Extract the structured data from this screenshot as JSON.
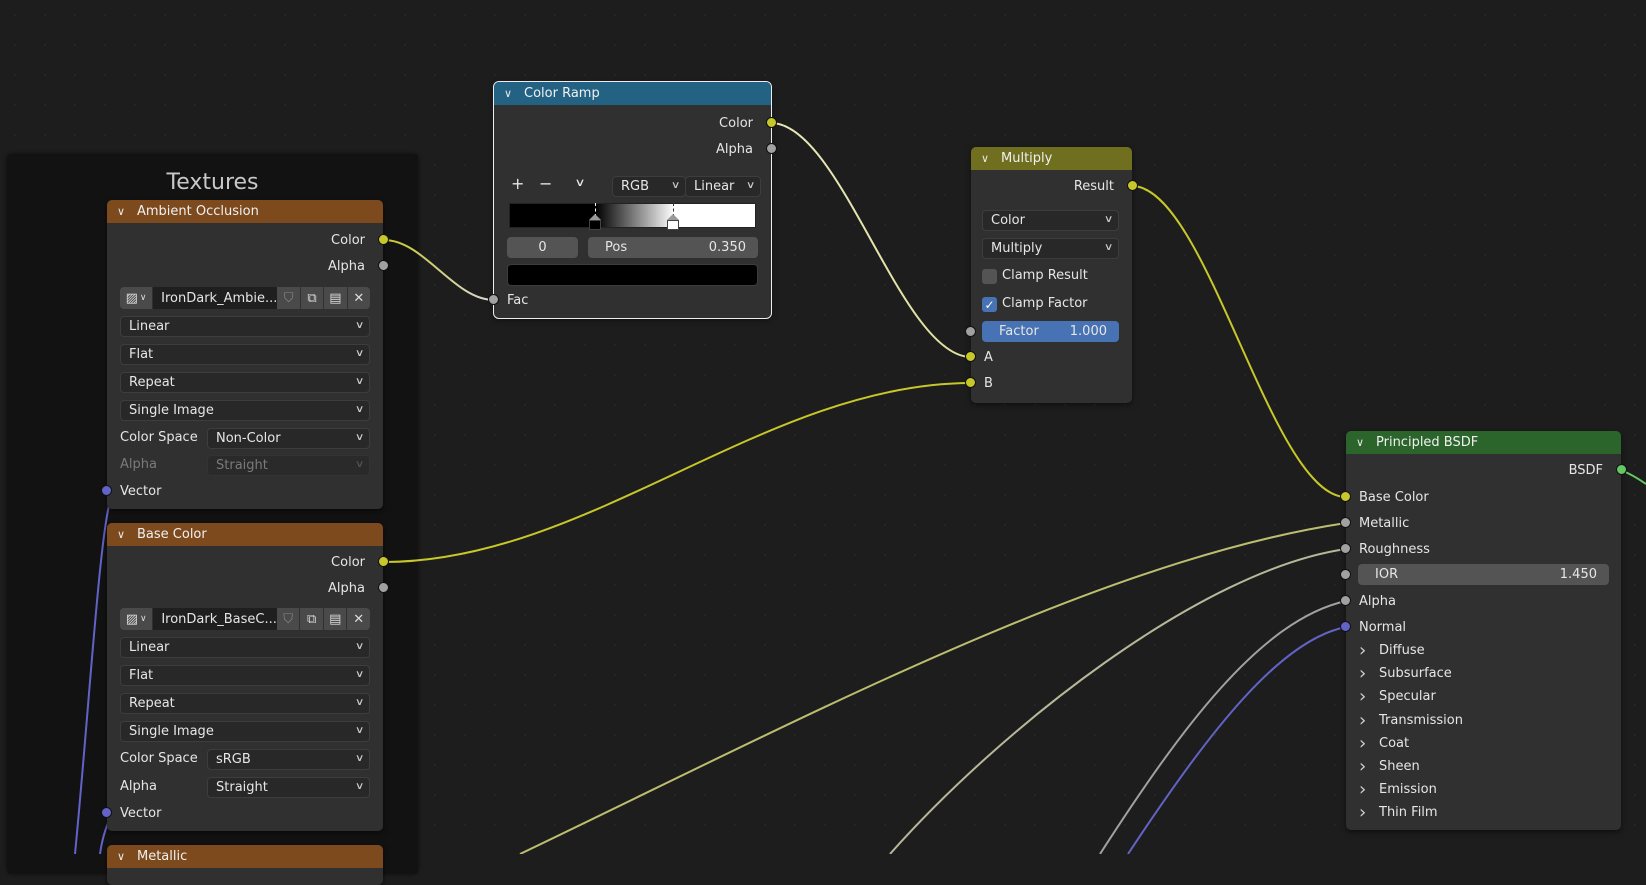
{
  "colors": {
    "texture_header": "#7d4a1e",
    "converter_header": "#246283",
    "color_header": "#6f6f1f",
    "shader_header": "#2b652b",
    "socket_color": "#c7c729",
    "socket_float": "#a1a1a1",
    "socket_vector": "#6363c7",
    "socket_shader": "#63c763",
    "accent": "#4772b3"
  },
  "frame": {
    "title": "Textures"
  },
  "ambient_occlusion": {
    "title": "Ambient Occlusion",
    "outputs": [
      "Color",
      "Alpha"
    ],
    "image_name": "IronDark_Ambie...",
    "interpolation": "Linear",
    "projection": "Flat",
    "extension": "Repeat",
    "source": "Single Image",
    "color_space_label": "Color Space",
    "color_space": "Non-Color",
    "alpha_label": "Alpha",
    "alpha_mode": "Straight",
    "input": "Vector"
  },
  "base_color": {
    "title": "Base Color",
    "outputs": [
      "Color",
      "Alpha"
    ],
    "image_name": "IronDark_BaseC...",
    "interpolation": "Linear",
    "projection": "Flat",
    "extension": "Repeat",
    "source": "Single Image",
    "color_space_label": "Color Space",
    "color_space": "sRGB",
    "alpha_label": "Alpha",
    "alpha_mode": "Straight",
    "input": "Vector"
  },
  "metallic": {
    "title": "Metallic"
  },
  "color_ramp": {
    "title": "Color Ramp",
    "outputs": [
      "Color",
      "Alpha"
    ],
    "add": "+",
    "remove": "−",
    "menu": "⌄",
    "color_mode": "RGB",
    "interpolation": "Linear",
    "stops": [
      {
        "position": 0.35,
        "color": "#000000"
      },
      {
        "position": 0.67,
        "color": "#ffffff"
      }
    ],
    "active_index": "0",
    "pos_label": "Pos",
    "pos_value": "0.350",
    "active_color": "#000000",
    "input": "Fac"
  },
  "multiply": {
    "title": "Multiply",
    "output": "Result",
    "data_type": "Color",
    "blend_type": "Multiply",
    "clamp_result_label": "Clamp Result",
    "clamp_result": false,
    "clamp_factor_label": "Clamp Factor",
    "clamp_factor": true,
    "factor_label": "Factor",
    "factor_value": "1.000",
    "inputs": [
      "A",
      "B"
    ]
  },
  "principled": {
    "title": "Principled BSDF",
    "output": "BSDF",
    "inputs": [
      "Base Color",
      "Metallic",
      "Roughness"
    ],
    "ior_label": "IOR",
    "ior_value": "1.450",
    "inputs2": [
      "Alpha",
      "Normal"
    ],
    "panels": [
      "Diffuse",
      "Subsurface",
      "Specular",
      "Transmission",
      "Coat",
      "Sheen",
      "Emission",
      "Thin Film"
    ]
  }
}
